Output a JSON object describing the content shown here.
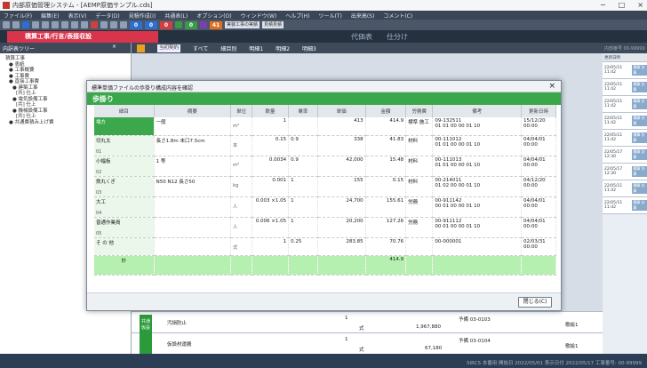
{
  "window": {
    "title": "内部原価管理システム - [AEMP原価サンプル.cds]",
    "min": "−",
    "max": "□",
    "close": "×"
  },
  "menu": [
    "ファイル(F)",
    "編集(E)",
    "表示(V)",
    "データ(D)",
    "見積作成(I)",
    "共通表(L)",
    "オプション(O)",
    "ウィンドウ(W)",
    "ヘルプ(H)",
    "ツール(T)",
    "出来高(S)",
    "コメント(C)"
  ],
  "toolbar": {
    "num1": "0",
    "num2": "0",
    "num3": "0",
    "num4": "0",
    "num5": "41",
    "box1": "実装工事の実績",
    "box2": "見積見積"
  },
  "tabs": {
    "active": "積算工事/行言/表接収設",
    "tab2": "代価表",
    "tab3": "仕分け"
  },
  "tree": {
    "title": "内訳表ツリー",
    "close": "×",
    "items": [
      "積算工事",
      "● 表紙",
      "● 工事概要",
      "● 工事費",
      "● 直接工事費",
      "● 建築工事",
      "[共] 仕上",
      "● 電気設備工事",
      "[共] 仕上",
      "● 機械設備工事",
      "[共] 仕上",
      "● 共通費積み上げ費"
    ]
  },
  "mainhead": {
    "dropdown": "当初契約",
    "b1": "すべて",
    "b2": "細目別",
    "b3": "明細1",
    "b4": "明細2",
    "b5": "明細3"
  },
  "rightpanel": {
    "head": "内部番号 00-99999",
    "col": "更新日時",
    "rows": [
      {
        "date": "22/05/11 11:42",
        "tag": "積算 計算"
      },
      {
        "date": "22/05/11 11:42",
        "tag": "積算 計算"
      },
      {
        "date": "22/05/11 11:42",
        "tag": "積算 計算"
      },
      {
        "date": "22/05/11 11:42",
        "tag": "積算 計算"
      },
      {
        "date": "22/05/11 11:42",
        "tag": "積算 計算"
      },
      {
        "date": "22/05/17 12:30",
        "tag": "積算 計算"
      },
      {
        "date": "22/05/17 12:30",
        "tag": "積算 計算"
      },
      {
        "date": "22/05/11 11:42",
        "tag": "積算 計算"
      },
      {
        "date": "22/05/11 11:42",
        "tag": "積算 計算"
      }
    ]
  },
  "below": [
    {
      "name": "汚損防止",
      "qty": "1",
      "unit": "式",
      "amount": "1,967,880",
      "code": "予備 03-0103",
      "flag": "歌絵1"
    },
    {
      "name": "仮設材運搬",
      "qty": "1",
      "unit": "式",
      "amount": "67,180",
      "code": "予備 03-0104",
      "flag": "歌絵1"
    }
  ],
  "side_label": "共通仮設",
  "status": "SIRCS 本番用 開始日 2022/05/01 表示日付 2022/05/17 工事番号: 00-99999",
  "dialog": {
    "title": "標準単価ファイルの歩掛り構成内容を確認",
    "banner": "歩掛り",
    "headers": [
      "細目",
      "摘要",
      "単位",
      "数量",
      "乗率",
      "単価",
      "金額",
      "労務費",
      "備考",
      "更新日時"
    ],
    "rows": [
      {
        "no": "",
        "name": "場方",
        "desc": "一般",
        "unit": "m³",
        "qty": "1",
        "rate": "",
        "price": "413",
        "amount": "414.9",
        "lab": "標準 施工",
        "note1": "09-132511",
        "note2": "01 01 00 00 01 10",
        "date": "15/12/20 00:00"
      },
      {
        "no": "01",
        "name": "切丸太",
        "desc": "長さ1.8m 末口7.5cm",
        "unit": "本",
        "qty": "0.15",
        "rate": "0.9",
        "price": "338",
        "amount": "41.83",
        "lab": "材料",
        "note1": "00-111012",
        "note2": "01 01 00 00 01 10",
        "date": "04/04/01 00:00"
      },
      {
        "no": "02",
        "name": "小幅板",
        "desc": "1 等",
        "unit": "m³",
        "qty": "0.0034",
        "rate": "0.9",
        "price": "42,000",
        "amount": "15.48",
        "lab": "材料",
        "note1": "00-111013",
        "note2": "01 01 00 00 01 10",
        "date": "04/04/01 00:00"
      },
      {
        "no": "03",
        "name": "鉄丸くぎ",
        "desc": "N50 N12 長さ50",
        "unit": "kg",
        "qty": "0.001",
        "rate": "1",
        "price": "155",
        "amount": "0.15",
        "lab": "材料",
        "note1": "00-214011",
        "note2": "01 02 00 00 01 10",
        "date": "04/12/20 00:00"
      },
      {
        "no": "04",
        "name": "大工",
        "desc": "",
        "unit": "人",
        "qty": "0.003 ×1.05",
        "rate": "1",
        "price": "24,700",
        "amount": "155.61",
        "lab": "労務",
        "note1": "00-911142",
        "note2": "00 01 00 00 01 10",
        "date": "04/04/01 00:00"
      },
      {
        "no": "05",
        "name": "普通作業員",
        "desc": "",
        "unit": "人",
        "qty": "0.006 ×1.05",
        "rate": "1",
        "price": "20,200",
        "amount": "127.26",
        "lab": "労務",
        "note1": "00-911112",
        "note2": "00 01 00 00 01 10",
        "date": "04/04/01 00:00"
      },
      {
        "no": "",
        "name": "そ の 他",
        "desc": "",
        "unit": "式",
        "qty": "1",
        "rate": "0.25",
        "price": "283.85",
        "amount": "70.76",
        "lab": "",
        "note1": "00-000001",
        "note2": "",
        "date": "02/03/31 00:00"
      }
    ],
    "total_label": "計",
    "total_amount": "414.9",
    "close_button": "閉じる(C)"
  }
}
